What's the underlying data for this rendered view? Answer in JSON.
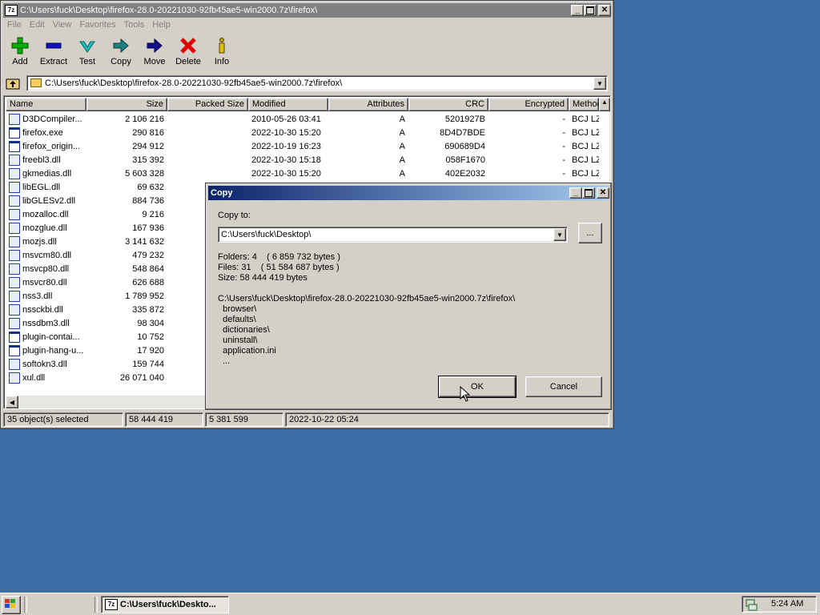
{
  "main_window": {
    "title": "C:\\Users\\fuck\\Desktop\\firefox-28.0-20221030-92fb45ae5-win2000.7z\\firefox\\",
    "app_icon": "7z-icon",
    "menu": [
      "File",
      "Edit",
      "View",
      "Favorites",
      "Tools",
      "Help"
    ],
    "toolbar": [
      {
        "label": "Add",
        "icon": "plus-icon",
        "color": "#00a000"
      },
      {
        "label": "Extract",
        "icon": "minus-icon",
        "color": "#0000a0"
      },
      {
        "label": "Test",
        "icon": "check-icon",
        "color": "#00a0a0"
      },
      {
        "label": "Copy",
        "icon": "copy-arrow-icon",
        "color": "#008080"
      },
      {
        "label": "Move",
        "icon": "move-arrow-icon",
        "color": "#000080"
      },
      {
        "label": "Delete",
        "icon": "delete-x-icon",
        "color": "#e00000"
      },
      {
        "label": "Info",
        "icon": "info-icon",
        "color": "#c0a000"
      }
    ],
    "address": "C:\\Users\\fuck\\Desktop\\firefox-28.0-20221030-92fb45ae5-win2000.7z\\firefox\\",
    "columns": [
      "Name",
      "Size",
      "Packed Size",
      "Modified",
      "Attributes",
      "CRC",
      "Encrypted",
      "Method"
    ],
    "visible_detail_rows": [
      {
        "modified": "2010-05-26 03:41",
        "attributes": "A",
        "crc": "5201927B",
        "encrypted": "-",
        "method": "BCJ LZM"
      },
      {
        "modified": "2022-10-30 15:20",
        "attributes": "A",
        "crc": "8D4D7BDE",
        "encrypted": "-",
        "method": "BCJ LZM"
      },
      {
        "modified": "2022-10-19 16:23",
        "attributes": "A",
        "crc": "690689D4",
        "encrypted": "-",
        "method": "BCJ LZM"
      },
      {
        "modified": "2022-10-30 15:18",
        "attributes": "A",
        "crc": "058F1670",
        "encrypted": "-",
        "method": "BCJ LZM"
      },
      {
        "modified": "2022-10-30 15:20",
        "attributes": "A",
        "crc": "402E2032",
        "encrypted": "-",
        "method": "BCJ LZM"
      }
    ],
    "files": [
      {
        "name": "D3DCompiler...",
        "size": "2 106 216",
        "kind": "dll"
      },
      {
        "name": "firefox.exe",
        "size": "290 816",
        "kind": "exe"
      },
      {
        "name": "firefox_origin...",
        "size": "294 912",
        "kind": "exe"
      },
      {
        "name": "freebl3.dll",
        "size": "315 392",
        "kind": "dll"
      },
      {
        "name": "gkmedias.dll",
        "size": "5 603 328",
        "kind": "dll"
      },
      {
        "name": "libEGL.dll",
        "size": "69 632",
        "kind": "dll"
      },
      {
        "name": "libGLESv2.dll",
        "size": "884 736",
        "kind": "dll"
      },
      {
        "name": "mozalloc.dll",
        "size": "9 216",
        "kind": "dll"
      },
      {
        "name": "mozglue.dll",
        "size": "167 936",
        "kind": "dll"
      },
      {
        "name": "mozjs.dll",
        "size": "3 141 632",
        "kind": "dll"
      },
      {
        "name": "msvcm80.dll",
        "size": "479 232",
        "kind": "dll"
      },
      {
        "name": "msvcp80.dll",
        "size": "548 864",
        "kind": "dll"
      },
      {
        "name": "msvcr80.dll",
        "size": "626 688",
        "kind": "dll"
      },
      {
        "name": "nss3.dll",
        "size": "1 789 952",
        "kind": "dll"
      },
      {
        "name": "nssckbi.dll",
        "size": "335 872",
        "kind": "dll"
      },
      {
        "name": "nssdbm3.dll",
        "size": "98 304",
        "kind": "dll"
      },
      {
        "name": "plugin-contai...",
        "size": "10 752",
        "kind": "exe"
      },
      {
        "name": "plugin-hang-u...",
        "size": "17 920",
        "kind": "exe"
      },
      {
        "name": "softokn3.dll",
        "size": "159 744",
        "kind": "dll"
      },
      {
        "name": "xul.dll",
        "size": "26 071 040",
        "kind": "dll"
      }
    ],
    "status": [
      "35 object(s) selected",
      "58 444 419",
      "5 381 599",
      "2022-10-22 05:24"
    ]
  },
  "copy_dialog": {
    "title": "Copy",
    "copy_to_label": "Copy to:",
    "destination": "C:\\Users\\fuck\\Desktop\\",
    "browse_label": "...",
    "folders_line": "Folders: 4    ( 6 859 732 bytes )",
    "files_line": "Files: 31    ( 51 584 687 bytes )",
    "size_line": "Size: 58 444 419 bytes",
    "paths": [
      "C:\\Users\\fuck\\Desktop\\firefox-28.0-20221030-92fb45ae5-win2000.7z\\firefox\\",
      "  browser\\",
      "  defaults\\",
      "  dictionaries\\",
      "  uninstall\\",
      "  application.ini",
      "  ..."
    ],
    "ok_label": "OK",
    "cancel_label": "Cancel"
  },
  "taskbar": {
    "task_label": "C:\\Users\\fuck\\Deskto...",
    "clock": "5:24 AM"
  },
  "colors": {
    "desktop": "#3a6ea5",
    "active_title_start": "#0a246a",
    "active_title_end": "#a6caf0",
    "inactive_title": "#808080"
  }
}
